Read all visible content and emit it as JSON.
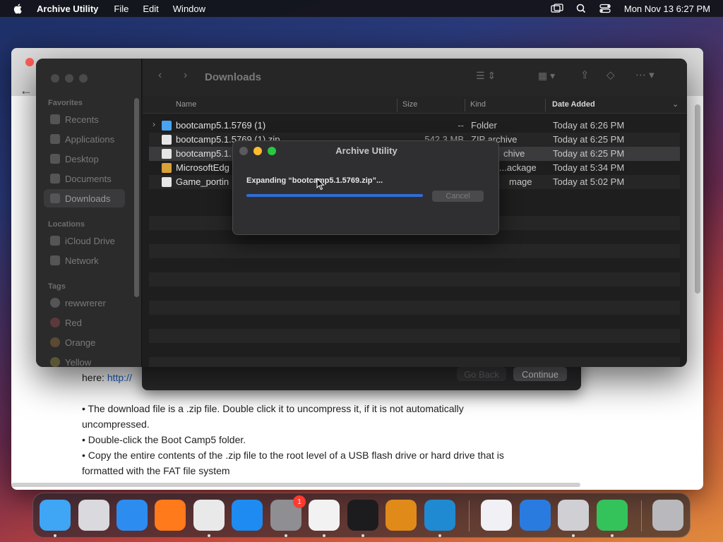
{
  "menubar": {
    "app_name": "Archive Utility",
    "menus": [
      "File",
      "Edit",
      "Window"
    ],
    "clock": "Mon Nov 13  6:27 PM"
  },
  "browser": {
    "here_text": "here:",
    "link_text": "http://",
    "bullet1": "• The download file is a .zip file. Double click it to uncompress it,  if it is not automatically",
    "bullet1_cont": "uncompressed.",
    "bullet2": "• Double-click the Boot Camp5 folder.",
    "bullet3": "• Copy the entire contents of the .zip file to the root level of a USB flash drive or hard drive that is",
    "bullet3_cont": "formatted with the FAT file system"
  },
  "installer": {
    "go_back": "Go Back",
    "continue": "Continue"
  },
  "finder": {
    "title": "Downloads",
    "sidebar": {
      "favorites_label": "Favorites",
      "favorites": [
        "Recents",
        "Applications",
        "Desktop",
        "Documents",
        "Downloads"
      ],
      "locations_label": "Locations",
      "locations": [
        "iCloud Drive",
        "Network"
      ],
      "tags_label": "Tags",
      "tags": [
        "rewwrerer",
        "Red",
        "Orange",
        "Yellow"
      ]
    },
    "columns": {
      "name": "Name",
      "size": "Size",
      "kind": "Kind",
      "date_added": "Date Added"
    },
    "rows": [
      {
        "name": "bootcamp5.1.5769 (1)",
        "size": "--",
        "kind": "Folder",
        "date": "Today at 6:26 PM"
      },
      {
        "name": "bootcamp5.1.5769 (1).zip",
        "size": "542.3 MB",
        "kind": "ZIP archive",
        "date": "Today at 6:25 PM"
      },
      {
        "name": "bootcamp5.1.",
        "size": "",
        "kind": "chive",
        "date": "Today at 6:25 PM"
      },
      {
        "name": "MicrosoftEdg",
        "size": "",
        "kind": "...ackage",
        "date": "Today at 5:34 PM"
      },
      {
        "name": "Game_portin",
        "size": "",
        "kind": "mage",
        "date": "Today at 5:02 PM"
      }
    ]
  },
  "archive_dialog": {
    "title": "Archive Utility",
    "status": "Expanding “bootcamp5.1.5769.zip”...",
    "cancel": "Cancel",
    "progress": 1.0
  },
  "dock": {
    "settings_badge": "1",
    "apps": [
      {
        "name": "finder",
        "color": "#3fa5f5"
      },
      {
        "name": "launchpad",
        "color": "#d9d9de"
      },
      {
        "name": "safari",
        "color": "#2d8cf0"
      },
      {
        "name": "firefox",
        "color": "#ff7a1a"
      },
      {
        "name": "chrome",
        "color": "#e9e9e9"
      },
      {
        "name": "app-store",
        "color": "#1d8bf1"
      },
      {
        "name": "system-settings",
        "color": "#8e8e93"
      },
      {
        "name": "textedit",
        "color": "#f2f2f2"
      },
      {
        "name": "terminal",
        "color": "#1c1c1e"
      },
      {
        "name": "garageband",
        "color": "#e08a1a"
      },
      {
        "name": "vscode",
        "color": "#1f8ad2"
      },
      {
        "name": "visual-studio",
        "color": "#f0f0f5"
      },
      {
        "name": "onedrive",
        "color": "#2a7be0"
      },
      {
        "name": "downloads",
        "color": "#cfcfd4"
      },
      {
        "name": "archive-utility",
        "color": "#33c35a"
      },
      {
        "name": "trash",
        "color": "#b8b8bd"
      }
    ]
  }
}
